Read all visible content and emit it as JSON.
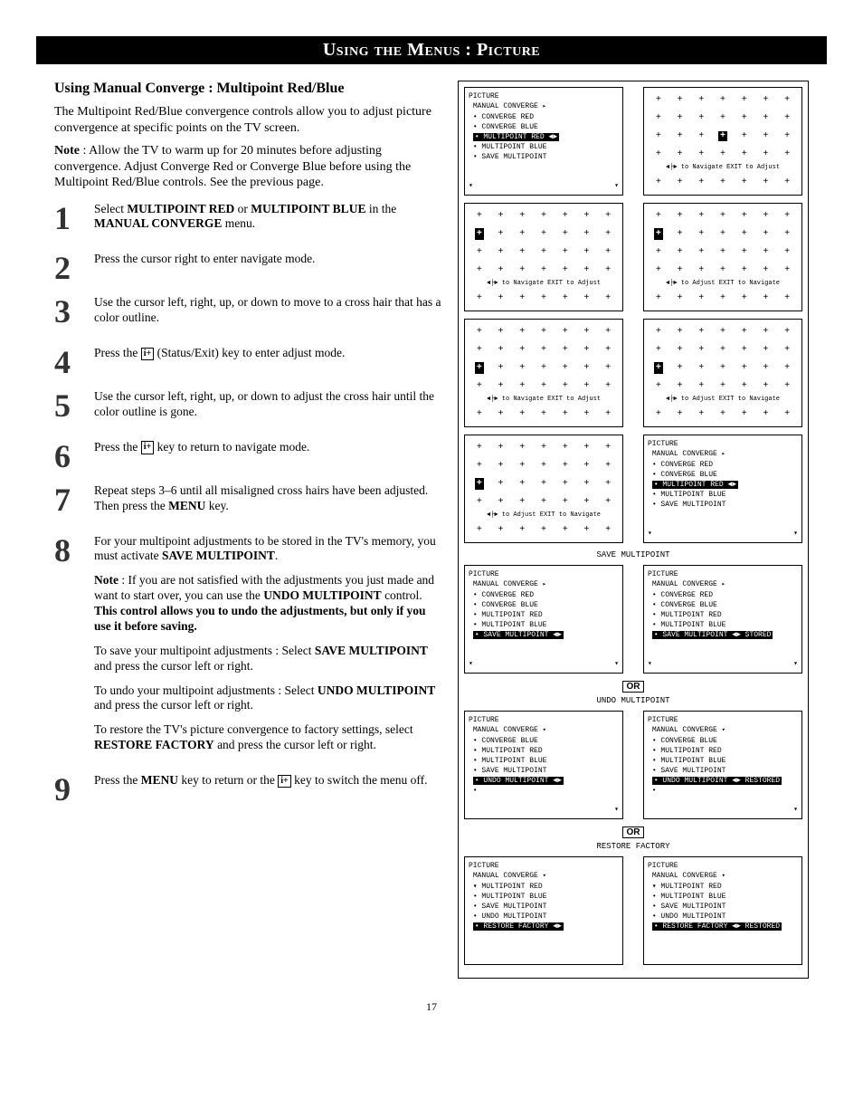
{
  "header": "Using the Menus : Picture",
  "subhead": "Using Manual Converge : Multipoint Red/Blue",
  "intro1": "The Multipoint Red/Blue convergence controls allow you to adjust picture convergence at specific points on the TV screen.",
  "intro2_note_label": "Note",
  "intro2": " : Allow the TV to warm up for 20 minutes before adjusting convergence. Adjust Converge Red or Converge Blue before using the Multipoint Red/Blue controls. See the previous page.",
  "steps": {
    "1": {
      "a": "Select ",
      "b": "MULTIPOINT RED",
      "c": " or ",
      "d": "MULTIPOINT BLUE",
      "e": " in the ",
      "f": "MANUAL CONVERGE",
      "g": " menu."
    },
    "2": "Press the cursor right to enter navigate mode.",
    "3": "Use the cursor left, right, up, or down to move to a cross hair that has a color outline.",
    "4a": "Press the ",
    "4b": " (Status/Exit) key to enter adjust mode.",
    "5": "Use the cursor left, right, up, or down to adjust the cross hair until the color outline is gone.",
    "6a": "Press the ",
    "6b": " key to return to navigate mode.",
    "7a": "Repeat steps 3–6 until all misaligned cross hairs have been adjusted. Then press the ",
    "7b": "MENU",
    "7c": " key.",
    "8a": "For your multipoint adjustments to be stored in the TV's memory, you must activate ",
    "8b": "SAVE MULTIPOINT",
    "8c": ".",
    "8note_label": "Note",
    "8note_a": " : If you are not satisfied with the adjustments you just made and want to start over, you can use the ",
    "8note_b": "UNDO MULTIPOINT",
    "8note_c": " control. ",
    "8note_d": "This control allows you to undo the adjustments, but only if you use it before saving.",
    "8save_a": "To save your multipoint adjustments : Select ",
    "8save_b": "SAVE MULTIPOINT",
    "8save_c": " and press the cursor left or right.",
    "8undo_a": "To undo your multipoint adjustments : Select ",
    "8undo_b": "UNDO MULTIPOINT",
    "8undo_c": " and press the cursor left or right.",
    "8rest_a": "To restore the TV's picture convergence to factory settings, select ",
    "8rest_b": "RESTORE FACTORY",
    "8rest_c": " and press the cursor left or right.",
    "9a": "Press the ",
    "9b": "MENU",
    "9c": " key to return or the ",
    "9d": " key to switch the menu off."
  },
  "menu": {
    "picture": "PICTURE",
    "manual_converge": "MANUAL CONVERGE",
    "converge_red": "CONVERGE RED",
    "converge_blue": "CONVERGE BLUE",
    "multipoint_red": "MULTIPOINT RED",
    "multipoint_blue": "MULTIPOINT BLUE",
    "save_multipoint": "SAVE MULTIPOINT",
    "undo_multipoint": "UNDO MULTIPOINT",
    "restore_factory": "RESTORE FACTORY",
    "stored": "STORED",
    "restored": "RESTORED",
    "arrows": "◄►"
  },
  "hints": {
    "nav_adjust": "◄├► to Navigate  EXIT to Adjust",
    "adjust_nav": "◄├► to Adjust  EXIT to Navigate"
  },
  "labels": {
    "save_multipoint": "SAVE MULTIPOINT",
    "undo_multipoint": "UNDO MULTIPOINT",
    "restore_factory": "RESTORE FACTORY",
    "or": "OR"
  },
  "icon": "i+",
  "page_number": "17"
}
